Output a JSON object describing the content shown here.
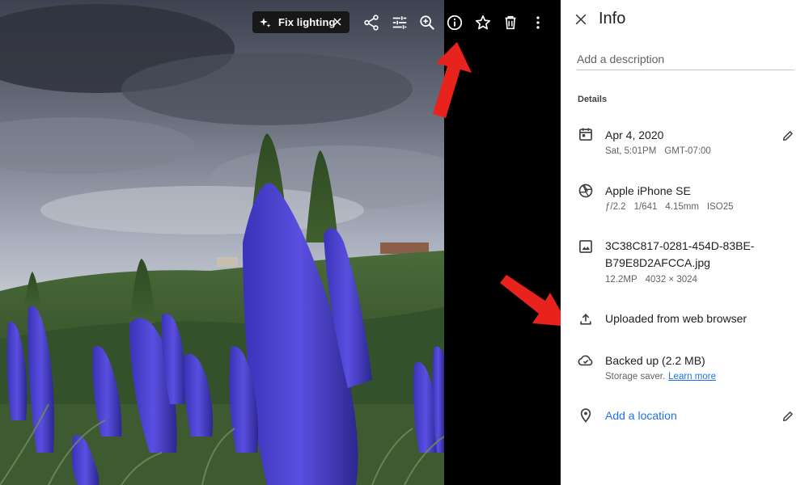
{
  "toolbar": {
    "fix_lighting_label": "Fix lighting"
  },
  "panel": {
    "title": "Info",
    "description_placeholder": "Add a description",
    "details_heading": "Details",
    "date": {
      "primary": "Apr 4, 2020",
      "day": "Sat, 5:01PM",
      "timezone": "GMT-07:00"
    },
    "camera": {
      "model": "Apple iPhone SE",
      "aperture": "ƒ/2.2",
      "shutter": "1/641",
      "focal_length": "4.15mm",
      "iso": "ISO25"
    },
    "file": {
      "name_line1": "3C38C817-0281-454D-83BE-",
      "name_line2": "B79E8D2AFCCA.jpg",
      "megapixels": "12.2MP",
      "dimensions": "4032 × 3024"
    },
    "upload": {
      "label": "Uploaded from web browser"
    },
    "backup": {
      "label": "Backed up (2.2 MB)",
      "storage_text": "Storage saver.",
      "learn_more": "Learn more"
    },
    "location": {
      "label": "Add a location"
    }
  },
  "colors": {
    "accent": "#1a73e8",
    "annotation_arrow": "#e8231e",
    "panel_bg": "#ffffff",
    "viewer_bg": "#000000"
  }
}
